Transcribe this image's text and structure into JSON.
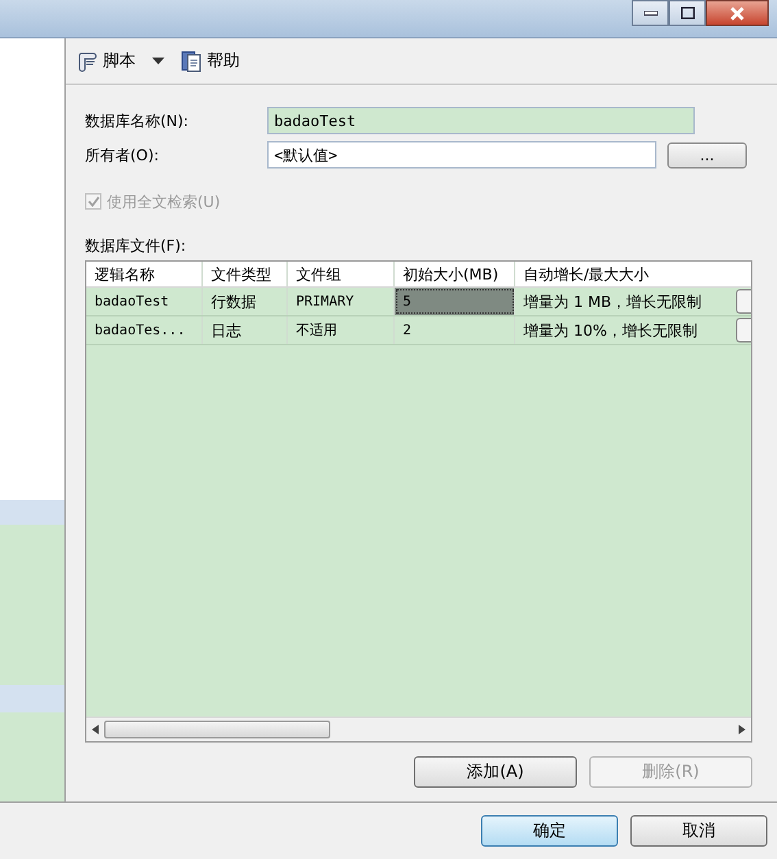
{
  "toolbar": [
    {
      "label": "脚本",
      "kind": "script",
      "dropdown": true
    },
    {
      "label": "帮助",
      "kind": "help",
      "dropdown": false
    }
  ],
  "fields": [
    {
      "label": "数据库名称(N):",
      "value": "badaoTest",
      "highlighted": true
    },
    {
      "label": "所有者(O):",
      "value": "<默认值>",
      "highlighted": false,
      "browse_button": "..."
    }
  ],
  "fulltext_checkbox": {
    "label": "使用全文检索(U)",
    "checked": true,
    "disabled": true
  },
  "files": {
    "label": "数据库文件(F):",
    "columns": [
      "逻辑名称",
      "文件类型",
      "文件组",
      "初始大小(MB)",
      "自动增长/最大大小"
    ],
    "rows": [
      {
        "cells": [
          {
            "text": "badaoTest",
            "selected": false
          },
          {
            "text": "行数据",
            "selected": false
          },
          {
            "text": "PRIMARY",
            "selected": false
          },
          {
            "text": "5",
            "selected": true
          },
          {
            "text": "增量为 1 MB，增长无限制",
            "selected": false
          }
        ]
      },
      {
        "cells": [
          {
            "text": "badaoTes...",
            "selected": false
          },
          {
            "text": "日志",
            "selected": false
          },
          {
            "text": "不适用",
            "selected": false
          },
          {
            "text": "2",
            "selected": false
          },
          {
            "text": "增量为 10%，增长无限制",
            "selected": false
          }
        ]
      }
    ]
  },
  "file_buttons": [
    {
      "label": "添加(A)",
      "disabled": false
    },
    {
      "label": "删除(R)",
      "disabled": true
    }
  ],
  "dialog_buttons": [
    {
      "label": "确定",
      "default": true
    },
    {
      "label": "取消",
      "default": false
    }
  ]
}
